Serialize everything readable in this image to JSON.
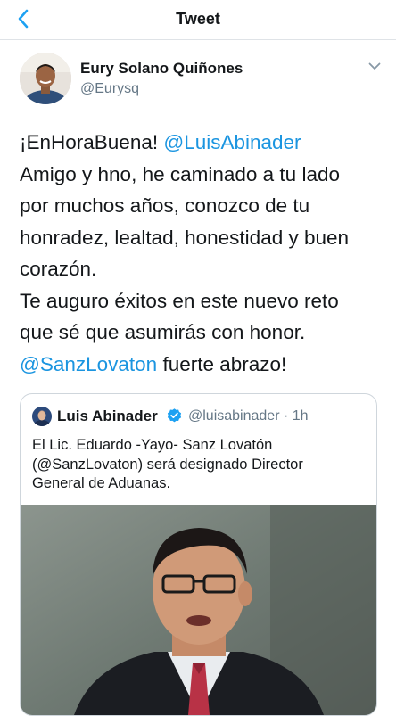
{
  "header": {
    "title": "Tweet",
    "back_icon": "chevron-left-icon",
    "accent_color": "#1da1f2"
  },
  "tweet": {
    "author_name": "Eury Solano Quiñones",
    "author_handle": "@Eurysq",
    "more_icon": "chevron-down-icon",
    "lines": [
      {
        "segments": [
          {
            "text": "¡EnHoraBuena! ",
            "mention": false
          },
          {
            "text": "@LuisAbinader",
            "mention": true
          }
        ]
      },
      {
        "segments": [
          {
            "text": "Amigo y hno, he caminado a tu lado",
            "mention": false
          }
        ]
      },
      {
        "segments": [
          {
            "text": "por muchos años, conozco de tu",
            "mention": false
          }
        ]
      },
      {
        "segments": [
          {
            "text": "honradez, lealtad, honestidad y buen",
            "mention": false
          }
        ]
      },
      {
        "segments": [
          {
            "text": "corazón.",
            "mention": false
          }
        ]
      },
      {
        "segments": [
          {
            "text": "Te auguro éxitos en este nuevo reto",
            "mention": false
          }
        ]
      },
      {
        "segments": [
          {
            "text": "que sé que asumirás con honor.",
            "mention": false
          }
        ]
      },
      {
        "segments": [
          {
            "text": "@SanzLovaton",
            "mention": true
          },
          {
            "text": " fuerte abrazo!",
            "mention": false
          }
        ]
      }
    ],
    "mention_color": "#1b95e0"
  },
  "quoted_tweet": {
    "author_name": "Luis Abinader",
    "verified_icon": "verified-badge-icon",
    "handle_time": "@luisabinader · 1h",
    "lines": [
      "El Lic. Eduardo -Yayo- Sanz Lovatón",
      "(@SanzLovaton) será designado Director",
      "General de Aduanas."
    ]
  }
}
